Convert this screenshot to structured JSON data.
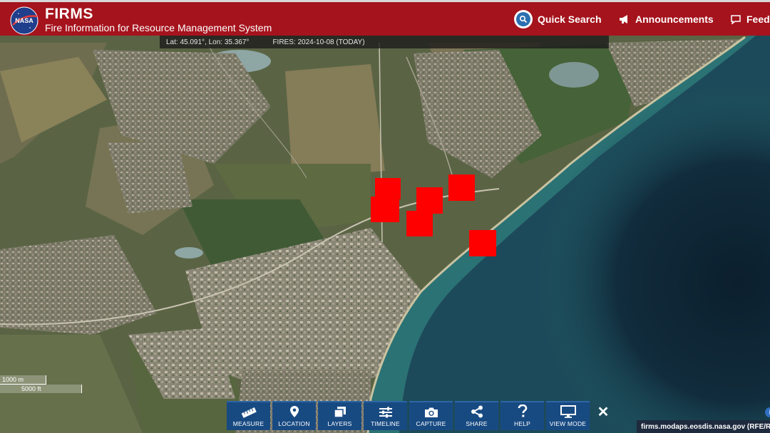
{
  "header": {
    "logo_text": "NASA",
    "title": "FIRMS",
    "subtitle": "Fire Information for Resource Management System",
    "nav": [
      {
        "label": "Quick Search",
        "icon": "search-icon"
      },
      {
        "label": "Announcements",
        "icon": "megaphone-icon"
      },
      {
        "label": "Feedb",
        "icon": "chat-icon"
      }
    ]
  },
  "coords": {
    "latlon": "Lat: 45.091°, Lon: 35.367°",
    "fires": "FIRES: 2024-10-08 (TODAY)"
  },
  "map": {
    "fire_markers_count": 6,
    "fire_color": "#ff0000",
    "sea_color": "#1d4a5a"
  },
  "scale": {
    "metric": "1000 m",
    "imperial": "5000 ft"
  },
  "toolbar": [
    {
      "label": "MEASURE",
      "icon": "ruler-icon"
    },
    {
      "label": "LOCATION",
      "icon": "location-pin-icon"
    },
    {
      "label": "LAYERS",
      "icon": "layers-icon"
    },
    {
      "label": "TIMELINE",
      "icon": "sliders-icon"
    },
    {
      "label": "CAPTURE",
      "icon": "camera-icon"
    },
    {
      "label": "SHARE",
      "icon": "share-icon"
    },
    {
      "label": "HELP",
      "icon": "question-icon"
    },
    {
      "label": "VIEW MODE",
      "icon": "monitor-icon"
    }
  ],
  "close_label": "✕",
  "attribution": "firms.modaps.eosdis.nasa.gov (RFE/RL)"
}
